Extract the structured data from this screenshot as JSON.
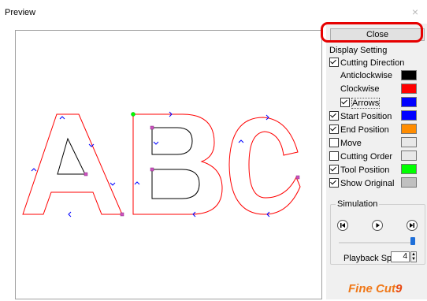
{
  "window": {
    "title": "Preview",
    "close_glyph": "×"
  },
  "panel": {
    "close_label": "Close",
    "display_setting_label": "Display Setting",
    "cutting_direction": {
      "label": "Cutting Direction",
      "checked": true
    },
    "anticlockwise": {
      "label": "Anticlockwise",
      "color": "#000000"
    },
    "clockwise": {
      "label": "Clockwise",
      "color": "#ff0000"
    },
    "arrows": {
      "label": "Arrows",
      "checked": true,
      "color": "#0000ff"
    },
    "start_position": {
      "label": "Start Position",
      "checked": true,
      "color": "#0000ff"
    },
    "end_position": {
      "label": "End Position",
      "checked": true,
      "color": "#ff8c00"
    },
    "move": {
      "label": "Move",
      "checked": false,
      "color": "#e8e8e8"
    },
    "cutting_order": {
      "label": "Cutting Order",
      "checked": false,
      "color": "#e8e8e8"
    },
    "tool_position": {
      "label": "Tool Position",
      "checked": true,
      "color": "#00ff00"
    },
    "show_original": {
      "label": "Show Original",
      "checked": true,
      "color": "#c0c0c0"
    }
  },
  "simulation": {
    "label": "Simulation",
    "buttons": [
      "skip-to-start-icon",
      "play-icon",
      "skip-to-end-icon"
    ],
    "progress": 1.0,
    "playback_speed_label": "Playback Speed",
    "playback_speed_value": "4"
  },
  "logo": {
    "text_main": "Fine Cut",
    "text_num": "9"
  }
}
